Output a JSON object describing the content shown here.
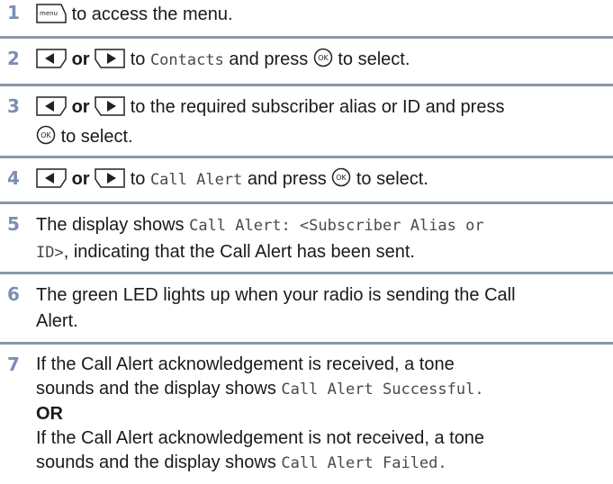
{
  "steps": [
    {
      "num": "1",
      "t1": "to access the menu.",
      "menu_key_label": "menu"
    },
    {
      "num": "2",
      "or": "or",
      "t1": "to",
      "mono1": "Contacts",
      "t2": "and press",
      "t3": "to select.",
      "ok_label": "OK"
    },
    {
      "num": "3",
      "or": "or",
      "t1": "to the required subscriber alias or ID and press",
      "t2": "to select.",
      "ok_label": "OK"
    },
    {
      "num": "4",
      "or": "or",
      "t1": "to",
      "mono1": "Call Alert",
      "t2": "and press",
      "t3": "to select.",
      "ok_label": "OK"
    },
    {
      "num": "5",
      "t1": "The display shows",
      "mono1": "Call Alert: <Subscriber Alias or",
      "mono2": "ID>",
      "t2": ", indicating that the Call Alert has been sent."
    },
    {
      "num": "6",
      "line1": "The green LED lights up when your radio is sending the Call",
      "line2": "Alert."
    },
    {
      "num": "7",
      "line1": "If the Call Alert acknowledgement is received, a tone",
      "line2": "sounds and the display shows",
      "mono1": "Call Alert Successful.",
      "or": "OR",
      "line3": "If the Call Alert acknowledgement is not received, a tone",
      "line4": "sounds and the display shows",
      "mono2": "Call Alert Failed."
    }
  ]
}
